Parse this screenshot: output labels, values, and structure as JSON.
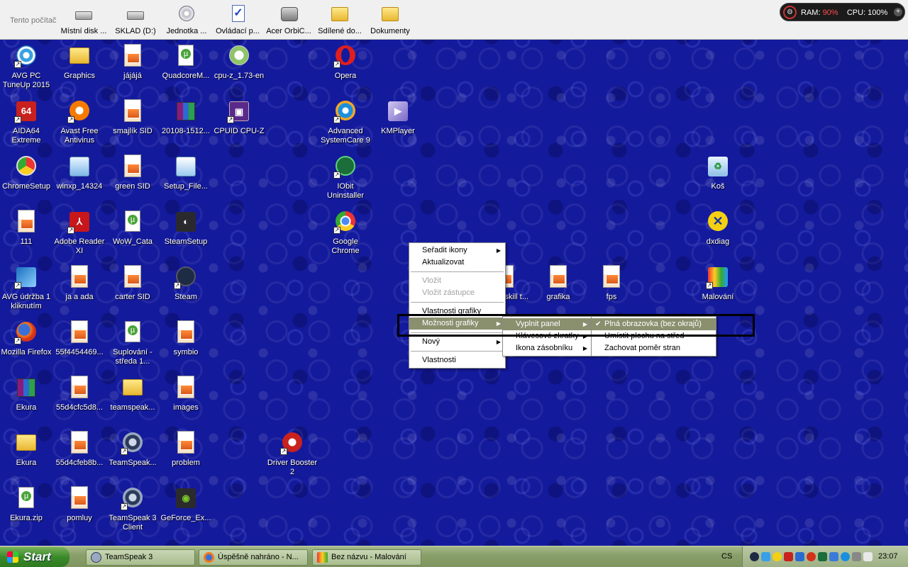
{
  "topbar": {
    "title": "Tento počítač",
    "items": [
      {
        "label": "Místní disk ...",
        "icon": "hard-drive-icon"
      },
      {
        "label": "SKLAD (D:)",
        "icon": "hard-drive-icon"
      },
      {
        "label": "Jednotka ...",
        "icon": "cd-drive-icon"
      },
      {
        "label": "Ovládací p...",
        "icon": "control-panel-icon"
      },
      {
        "label": "Acer OrbiC...",
        "icon": "webcam-icon"
      },
      {
        "label": "Sdílené do...",
        "icon": "folder-icon"
      },
      {
        "label": "Dokumenty",
        "icon": "folder-icon"
      }
    ]
  },
  "sysmon": {
    "ram_label": "RAM:",
    "ram_value": "90%",
    "cpu_label": "CPU:",
    "cpu_value": "100%",
    "plus": "+"
  },
  "desktop": {
    "icons": [
      {
        "label": "AVG PC TuneUp 2015",
        "icon": "avg-tuneup-icon"
      },
      {
        "label": "Graphics",
        "icon": "folder-icon"
      },
      {
        "label": "jájájá",
        "icon": "image-file-icon"
      },
      {
        "label": "QuadcoreM...",
        "icon": "document-icon"
      },
      {
        "label": "cpu-z_1.73-en",
        "icon": "installer-icon"
      },
      {
        "label": "Opera",
        "icon": "opera-icon"
      },
      {
        "label": "AIDA64 Extreme",
        "icon": "aida64-icon"
      },
      {
        "label": "Avast Free Antivirus",
        "icon": "avast-icon"
      },
      {
        "label": "smajlík SID",
        "icon": "image-file-icon"
      },
      {
        "label": "20108-1512...",
        "icon": "winrar-icon"
      },
      {
        "label": "CPUID CPU-Z",
        "icon": "cpuz-icon"
      },
      {
        "label": "Advanced SystemCare 9",
        "icon": "systemcare-icon"
      },
      {
        "label": "KMPlayer",
        "icon": "kmplayer-icon"
      },
      {
        "label": "ChromeSetup",
        "icon": "chrome-setup-icon"
      },
      {
        "label": "winxp_14324",
        "icon": "disc-image-icon"
      },
      {
        "label": "green SID",
        "icon": "image-file-icon"
      },
      {
        "label": "Setup_File...",
        "icon": "setup-icon"
      },
      {
        "label": "IObit Uninstaller",
        "icon": "iobit-icon"
      },
      {
        "label": "Koš",
        "icon": "recycle-bin-icon"
      },
      {
        "label": "111",
        "icon": "image-file-icon"
      },
      {
        "label": "Adobe Reader XI",
        "icon": "adobe-reader-icon"
      },
      {
        "label": "WoW_Cata",
        "icon": "torrent-icon"
      },
      {
        "label": "SteamSetup",
        "icon": "steam-icon"
      },
      {
        "label": "Google Chrome",
        "icon": "chrome-icon"
      },
      {
        "label": "dxdiag",
        "icon": "dxdiag-icon"
      },
      {
        "label": "AVG údržba 1 kliknutím",
        "icon": "avg-icon"
      },
      {
        "label": "ja a ada",
        "icon": "image-file-icon"
      },
      {
        "label": "carter SID",
        "icon": "image-file-icon"
      },
      {
        "label": "Steam",
        "icon": "steam-icon"
      },
      {
        "label": "o awp skill t...",
        "icon": "image-file-icon"
      },
      {
        "label": "grafika",
        "icon": "image-file-icon"
      },
      {
        "label": "fps",
        "icon": "image-file-icon"
      },
      {
        "label": "Malování",
        "icon": "paint-icon"
      },
      {
        "label": "Mozilla Firefox",
        "icon": "firefox-icon"
      },
      {
        "label": "55f4454469...",
        "icon": "image-file-icon"
      },
      {
        "label": "Suplování - středa 1...",
        "icon": "document-icon"
      },
      {
        "label": "symbio",
        "icon": "image-file-icon"
      },
      {
        "label": "Ekura",
        "icon": "winrar-icon"
      },
      {
        "label": "55d4cfc5d8...",
        "icon": "image-file-icon"
      },
      {
        "label": "teamspeak...",
        "icon": "folder-icon"
      },
      {
        "label": "images",
        "icon": "image-file-icon"
      },
      {
        "label": "Ekura",
        "icon": "folder-icon"
      },
      {
        "label": "55d4cfeb8b...",
        "icon": "image-file-icon"
      },
      {
        "label": "TeamSpeak...",
        "icon": "teamspeak-icon"
      },
      {
        "label": "problem",
        "icon": "image-file-icon"
      },
      {
        "label": "Driver Booster 2",
        "icon": "driver-booster-icon"
      },
      {
        "label": "Ekura.zip",
        "icon": "torrent-icon"
      },
      {
        "label": "pomluy",
        "icon": "image-file-icon"
      },
      {
        "label": "TeamSpeak 3 Client",
        "icon": "teamspeak-icon"
      },
      {
        "label": "GeForce_Ex...",
        "icon": "nvidia-icon"
      }
    ]
  },
  "context_menu": {
    "sort_icons": "Seřadit ikony",
    "refresh": "Aktualizovat",
    "paste": "Vložit",
    "paste_shortcut": "Vložit zástupce",
    "graphics_properties": "Vlastnosti grafiky",
    "graphics_options": "Možnosti grafiky",
    "new": "Nový",
    "properties": "Vlastnosti"
  },
  "submenu1": {
    "fill_panel": "Vyplnit panel",
    "hotkeys": "Klávesové zkratky",
    "tray_icon": "Ikona zásobníku"
  },
  "submenu2": {
    "full_screen": "Plná obrazovka (bez okrajů)",
    "center": "Umístit plochu na střed",
    "keep_aspect": "Zachovat poměr stran"
  },
  "taskbar": {
    "start_label": "Start",
    "tasks": [
      {
        "label": "TeamSpeak 3",
        "icon": "teamspeak-icon"
      },
      {
        "label": "Úspěšně nahráno - N...",
        "icon": "firefox-icon"
      },
      {
        "label": "Bez názvu - Malování",
        "icon": "paint-icon"
      }
    ],
    "language": "CS",
    "clock": "23:07"
  }
}
